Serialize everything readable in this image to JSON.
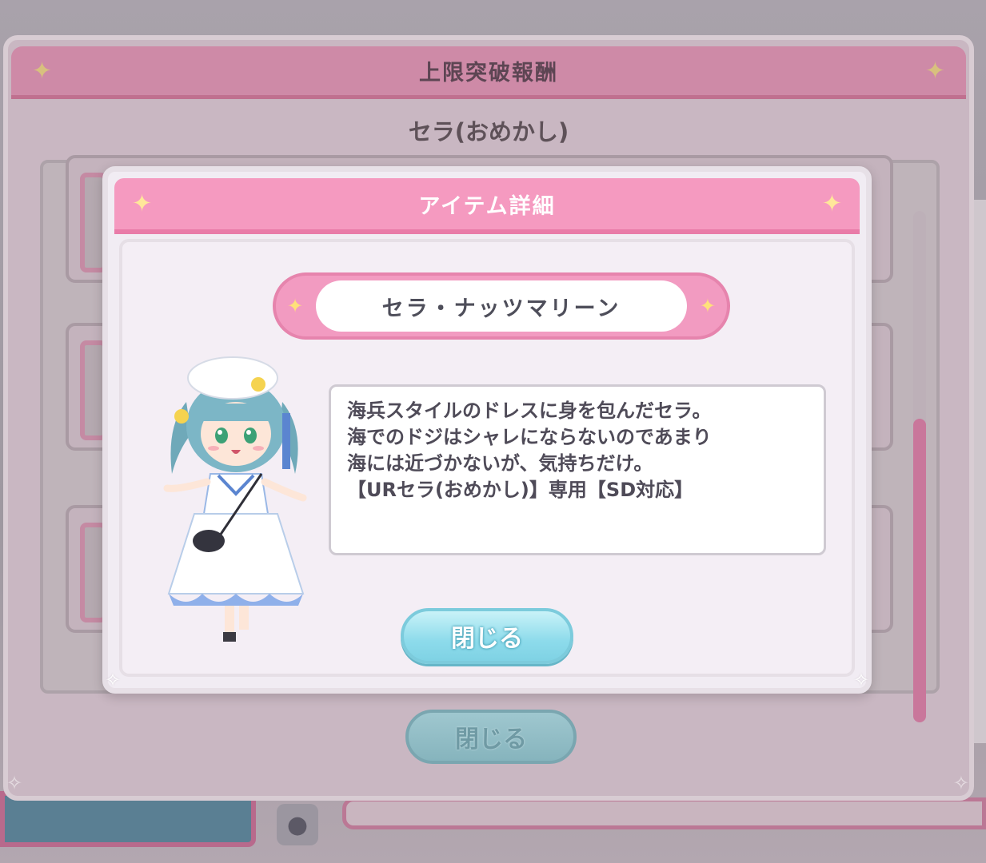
{
  "outer_dialog": {
    "title": "上限突破報酬",
    "subtitle": "セラ(おめかし)",
    "close_label": "閉じる"
  },
  "item_detail": {
    "title": "アイテム詳細",
    "item_name": "セラ・ナッツマリーン",
    "description_lines": [
      "海兵スタイルのドレスに身を包んだセラ。",
      "海でのドジはシャレにならないのであまり",
      "海には近づかないが、気持ちだけ。",
      "【URセラ(おめかし)】専用【SD対応】"
    ],
    "close_label": "閉じる"
  },
  "icons": {
    "sparkle": "sparkle-icon",
    "corner": "corner-diamond-icon",
    "character": "character-sd-image"
  },
  "colors": {
    "header_pink": "#f59ac0",
    "close_button_cyan": "#8ddbeb",
    "outer_header": "#ce8aa7"
  }
}
